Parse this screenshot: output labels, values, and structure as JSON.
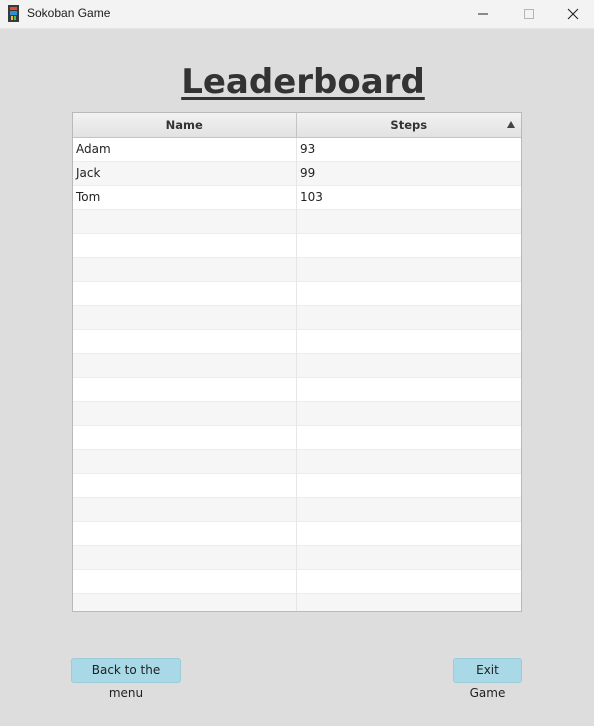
{
  "window": {
    "title": "Sokoban Game",
    "icon": "sokoban-app-icon",
    "controls": [
      "minimize-icon",
      "maximize-icon",
      "close-icon"
    ]
  },
  "heading": "Leaderboard",
  "table": {
    "columns": [
      {
        "label": "Name"
      },
      {
        "label": "Steps",
        "sorted": "ascending"
      }
    ],
    "rows": [
      {
        "name": "Adam",
        "steps": "93"
      },
      {
        "name": "Jack",
        "steps": "99"
      },
      {
        "name": "Tom",
        "steps": "103"
      }
    ]
  },
  "buttons": {
    "back": "Back to the menu",
    "exit": "Exit Game"
  },
  "colors": {
    "background": "#dddddd",
    "button": "#a9d8e6",
    "heading": "#333333"
  }
}
